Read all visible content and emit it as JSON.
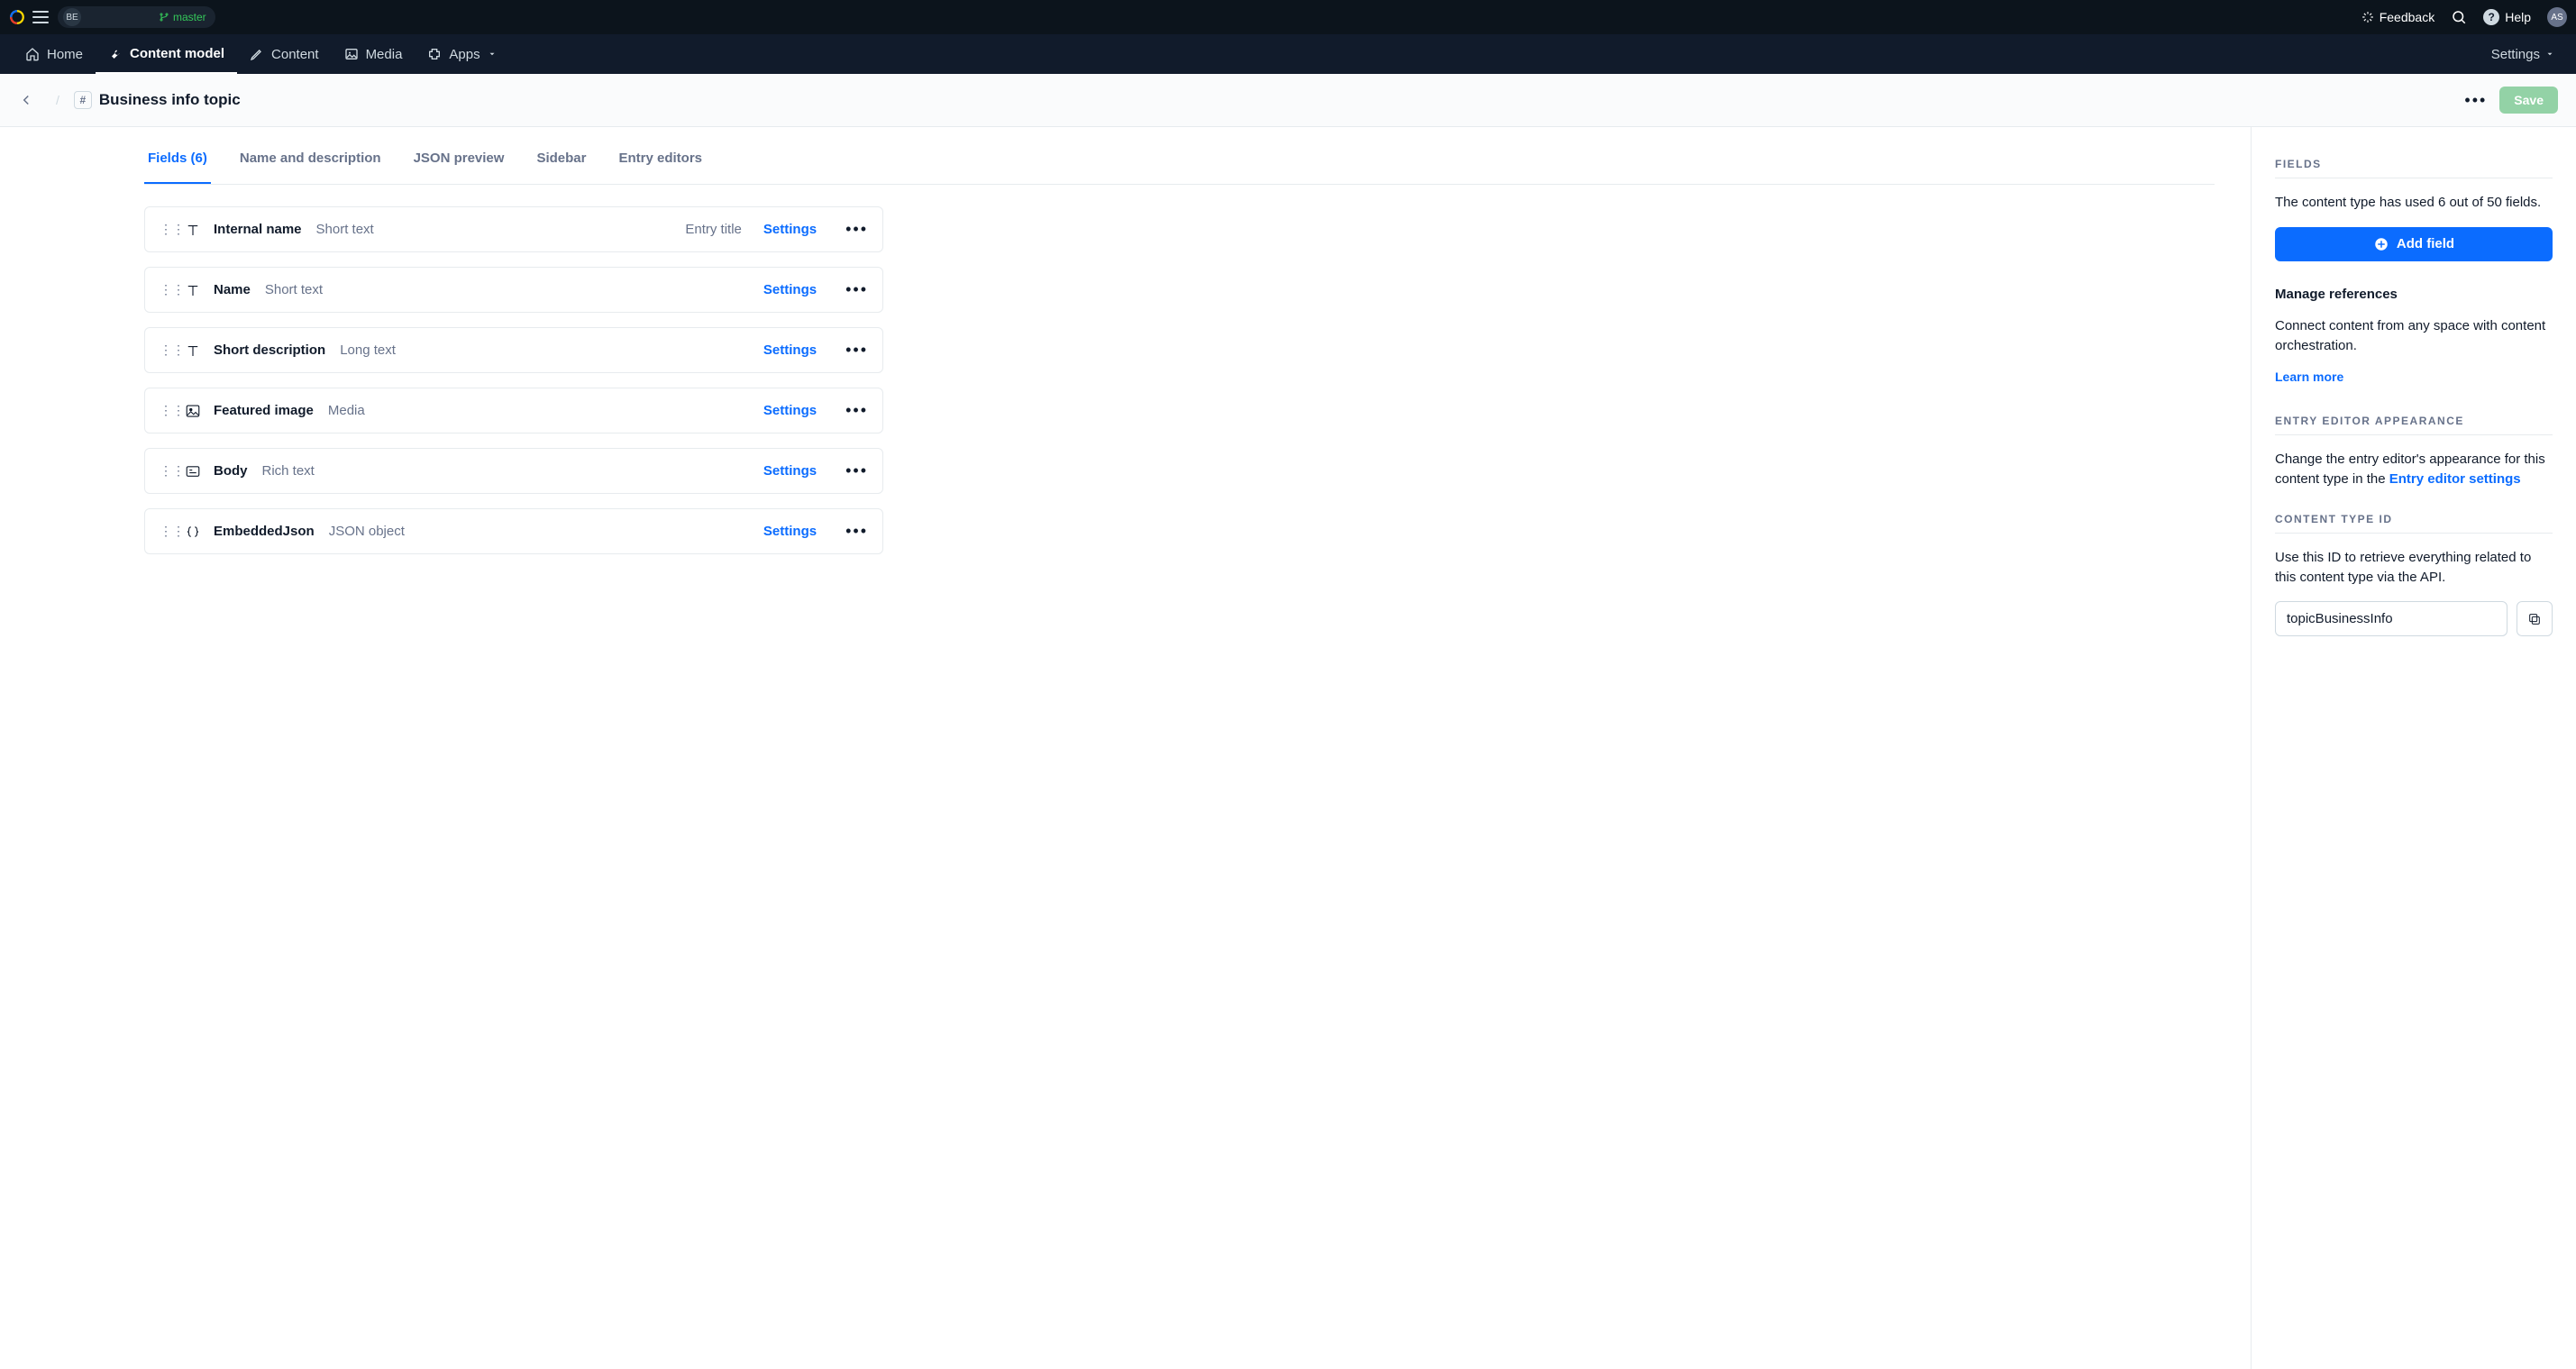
{
  "topbar": {
    "space_code": "BE",
    "branch_label": "master",
    "feedback_label": "Feedback",
    "help_label": "Help",
    "avatar_initials": "AS"
  },
  "nav": {
    "home": "Home",
    "content_model": "Content model",
    "content": "Content",
    "media": "Media",
    "apps": "Apps",
    "settings": "Settings"
  },
  "header": {
    "title": "Business info topic",
    "save_label": "Save"
  },
  "tabs": {
    "fields": "Fields (6)",
    "name_desc": "Name and description",
    "json": "JSON preview",
    "sidebar": "Sidebar",
    "entry_editors": "Entry editors"
  },
  "fields": [
    {
      "icon": "text",
      "name": "Internal name",
      "type": "Short text",
      "entry_title": "Entry title"
    },
    {
      "icon": "text",
      "name": "Name",
      "type": "Short text"
    },
    {
      "icon": "text",
      "name": "Short description",
      "type": "Long text"
    },
    {
      "icon": "media",
      "name": "Featured image",
      "type": "Media"
    },
    {
      "icon": "richtext",
      "name": "Body",
      "type": "Rich text"
    },
    {
      "icon": "json",
      "name": "EmbeddedJson",
      "type": "JSON object"
    }
  ],
  "row_settings_label": "Settings",
  "sidebar": {
    "fields_heading": "Fields",
    "used_text": "The content type has used 6 out of 50 fields.",
    "add_field_label": "Add field",
    "manage_refs_heading": "Manage references",
    "manage_refs_text": "Connect content from any space with content orchestration.",
    "learn_more": "Learn more",
    "editor_heading": "Entry editor appearance",
    "editor_text_a": "Change the entry editor's appearance for this content type in the ",
    "editor_link": "Entry editor settings",
    "ctid_heading": "Content type ID",
    "ctid_text": "Use this ID to retrieve everything related to this content type via the API.",
    "ctid_value": "topicBusinessInfo"
  }
}
